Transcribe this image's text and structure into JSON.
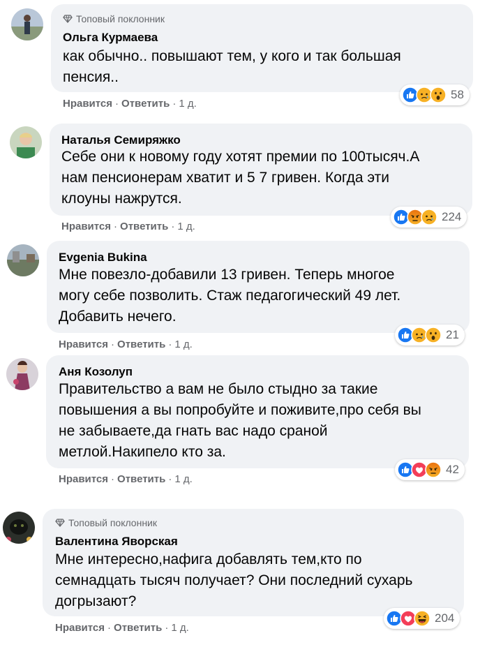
{
  "comments": [
    {
      "badge": "Топовый поклонник",
      "author": "Ольга Курмаева",
      "text": "как обычно.. повышают тем, у кого и так большая\nпенсия..",
      "like": "Нравится",
      "reply": "Ответить",
      "time": "1 д.",
      "reactions": [
        "like",
        "sad",
        "wow"
      ],
      "count": "58"
    },
    {
      "badge": "",
      "author": "Наталья Семиряжко",
      "text": "Себе они к новому году хотят премии по 100тысяч.А\nнам пенсионерам хватит и 5 7 гривен. Когда эти\nклоуны нажрутся.",
      "like": "Нравится",
      "reply": "Ответить",
      "time": "1 д.",
      "reactions": [
        "like",
        "angry",
        "sad"
      ],
      "count": "224"
    },
    {
      "badge": "",
      "author": "Evgenia Bukina",
      "text": "Мне повезло-добавили 13 гривен. Теперь многое\nмогу себе позволить. Стаж педагогический 49 лет.\nДобавить нечего.",
      "like": "Нравится",
      "reply": "Ответить",
      "time": "1 д.",
      "reactions": [
        "like",
        "sad",
        "wow"
      ],
      "count": "21"
    },
    {
      "badge": "",
      "author": "Аня Козолуп",
      "text": "Правительство а вам не было стыдно за такие\nповышения а вы попробуйте и поживите,про себя вы\nне забываете,да гнать вас надо сраной\nметлой.Накипело кто за.",
      "like": "Нравится",
      "reply": "Ответить",
      "time": "1 д.",
      "reactions": [
        "like",
        "love",
        "angry"
      ],
      "count": "42"
    },
    {
      "badge": "Топовый поклонник",
      "author": "Валентина Яворская",
      "text": "Мне интересно,нафига добавлять тем,кто по\nсемнадцать тысяч получает? Они последний сухарь\nдогрызают?",
      "like": "Нравится",
      "reply": "Ответить",
      "time": "1 д.",
      "reactions": [
        "like",
        "love",
        "haha"
      ],
      "count": "204"
    }
  ],
  "colors": {
    "bubble": "#f0f2f5",
    "meta": "#65676b",
    "like_blue": "#1877f2"
  }
}
